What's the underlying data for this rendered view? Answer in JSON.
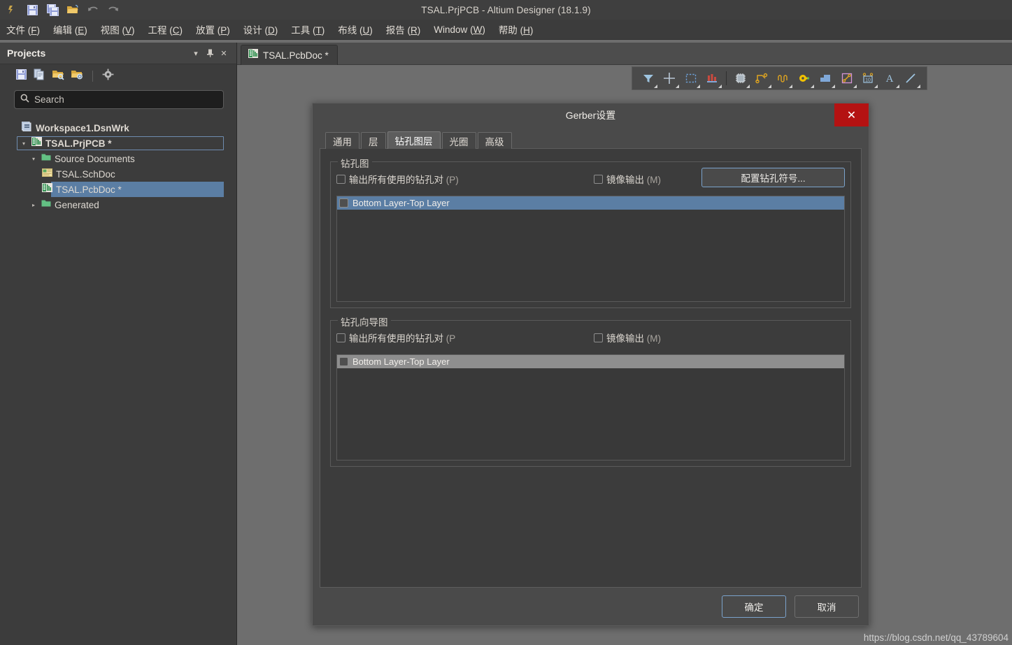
{
  "window": {
    "title": "TSAL.PrjPCB - Altium Designer (18.1.9)"
  },
  "quick_access": {
    "items": [
      {
        "name": "app-logo-icon",
        "label": "Altium"
      },
      {
        "name": "save-icon",
        "label": "保存"
      },
      {
        "name": "save-all-icon",
        "label": "全部保存"
      },
      {
        "name": "open-folder-icon",
        "label": "打开"
      },
      {
        "name": "undo-icon",
        "label": "撤销"
      },
      {
        "name": "redo-icon",
        "label": "重做"
      }
    ]
  },
  "menubar": {
    "items": [
      {
        "text": "文件",
        "key": "F"
      },
      {
        "text": "编辑",
        "key": "E"
      },
      {
        "text": "视图",
        "key": "V"
      },
      {
        "text": "工程",
        "key": "C"
      },
      {
        "text": "放置",
        "key": "P"
      },
      {
        "text": "设计",
        "key": "D"
      },
      {
        "text": "工具",
        "key": "T"
      },
      {
        "text": "布线",
        "key": "U"
      },
      {
        "text": "报告",
        "key": "R"
      },
      {
        "text": "Window",
        "key": "W"
      },
      {
        "text": "帮助",
        "key": "H"
      }
    ]
  },
  "projects_panel": {
    "title": "Projects",
    "header_buttons": [
      {
        "name": "panel-dropdown-icon",
        "glyph": "▾"
      },
      {
        "name": "panel-pin-icon",
        "glyph": "✜"
      },
      {
        "name": "panel-close-icon",
        "glyph": "✕"
      }
    ],
    "toolbar": [
      {
        "name": "save-project-icon"
      },
      {
        "name": "copy-documents-icon"
      },
      {
        "name": "open-project-icon"
      },
      {
        "name": "project-options-icon"
      },
      {
        "name": "settings-gear-icon"
      }
    ],
    "search": {
      "placeholder": "Search",
      "value": ""
    },
    "tree": [
      {
        "label": "Workspace1.DsnWrk",
        "indent": 0,
        "bold": true,
        "arrow": "",
        "icon": "workspace-icon",
        "state": "normal"
      },
      {
        "label": "TSAL.PrjPCB *",
        "indent": 1,
        "bold": true,
        "arrow": "▾",
        "icon": "pcb-project-icon",
        "state": "focused"
      },
      {
        "label": "Source Documents",
        "indent": 2,
        "bold": false,
        "arrow": "▾",
        "icon": "folder-icon",
        "state": "normal"
      },
      {
        "label": "TSAL.SchDoc",
        "indent": 3,
        "bold": false,
        "arrow": "",
        "icon": "schematic-icon",
        "state": "normal"
      },
      {
        "label": "TSAL.PcbDoc *",
        "indent": 3,
        "bold": false,
        "arrow": "",
        "icon": "pcb-doc-icon",
        "state": "selected"
      },
      {
        "label": "Generated",
        "indent": 2,
        "bold": false,
        "arrow": "▸",
        "icon": "folder-icon",
        "state": "normal"
      }
    ]
  },
  "document_tab": {
    "label": "TSAL.PcbDoc *",
    "icon": "pcb-doc-icon"
  },
  "pcb_toolbar": {
    "items": [
      {
        "name": "filter-funnel-icon"
      },
      {
        "name": "crosshair-icon"
      },
      {
        "name": "selection-rectangle-icon"
      },
      {
        "name": "layer-stack-icon"
      },
      {
        "name": "place-component-icon"
      },
      {
        "name": "interactive-routing-icon"
      },
      {
        "name": "meander-route-icon"
      },
      {
        "name": "place-via-icon"
      },
      {
        "name": "place-polygon-icon"
      },
      {
        "name": "place-pad-icon"
      },
      {
        "name": "place-dimension-icon"
      },
      {
        "name": "place-text-icon"
      },
      {
        "name": "place-line-icon"
      }
    ]
  },
  "dialog": {
    "title": "Gerber设置",
    "close_label": "✕",
    "tabs": [
      {
        "label": "通用",
        "active": false
      },
      {
        "label": "层",
        "active": false
      },
      {
        "label": "钻孔图层",
        "active": true
      },
      {
        "label": "光圈",
        "active": false
      },
      {
        "label": "高级",
        "active": false
      }
    ],
    "drill_drawing": {
      "group_label": "钻孔图",
      "output_all_pairs": {
        "label_main": "输出所有使用的钻孔对 ",
        "label_key": "(P)",
        "checked": false
      },
      "mirror_output": {
        "label_main": "镜像输出 ",
        "label_key": "(M)",
        "checked": false
      },
      "configure_button": "配置钻孔符号...",
      "rows": [
        {
          "label": "Bottom Layer-Top Layer",
          "checked": false,
          "selection": "active"
        }
      ]
    },
    "drill_guide": {
      "group_label": "钻孔向导图",
      "output_all_pairs": {
        "label_main": "输出所有使用的钻孔对 ",
        "label_key": "(P",
        "checked": false
      },
      "mirror_output": {
        "label_main": "镜像输出 ",
        "label_key": "(M)",
        "checked": false
      },
      "rows": [
        {
          "label": "Bottom Layer-Top Layer",
          "checked": false,
          "selection": "inactive"
        }
      ]
    },
    "footer": {
      "ok": "确定",
      "cancel": "取消"
    }
  },
  "watermark": "https://blog.csdn.net/qq_43789604",
  "colors": {
    "window_bg": "#6e6e6e",
    "panel_bg": "#3c3c3c",
    "titlebar_bg": "#3f3f3f",
    "accent_blue": "#7ba3cc",
    "selection_active": "#5b7ea4",
    "selection_inactive": "#8e8e8e",
    "close_red": "#b41212"
  }
}
